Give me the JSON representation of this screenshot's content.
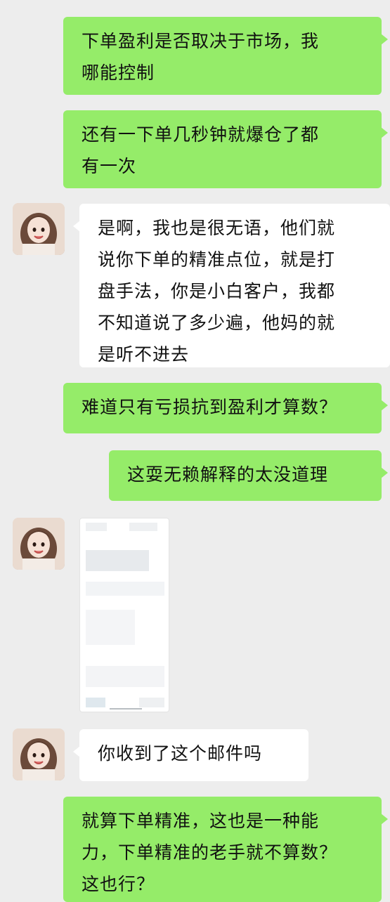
{
  "chat": {
    "messages": [
      {
        "side": "out",
        "text": "下单盈利是否取决于市场，我\n哪能控制"
      },
      {
        "side": "out",
        "text": "还有一下单几秒钟就爆仓了都\n有一次"
      },
      {
        "side": "in",
        "text": "是啊，我也是很无语，他们就\n说你下单的精准点位，就是打\n盘手法，你是小白客户，我都\n不知道说了多少遍，他妈的就\n是听不进去"
      },
      {
        "side": "out",
        "text": "难道只有亏损抗到盈利才算数？"
      },
      {
        "side": "out",
        "text": "这耍无赖解释的太没道理"
      },
      {
        "side": "in",
        "type": "image"
      },
      {
        "side": "in",
        "text": "你收到了这个邮件吗"
      },
      {
        "side": "out",
        "text": "就算下单精准，这也是一种能\n力，下单精准的老手就不算数？\n这也行？"
      }
    ]
  },
  "colors": {
    "background": "#ededed",
    "outgoing_bubble": "#95ec69",
    "incoming_bubble": "#ffffff"
  },
  "icons": {
    "avatar": "contact-avatar-photo"
  }
}
